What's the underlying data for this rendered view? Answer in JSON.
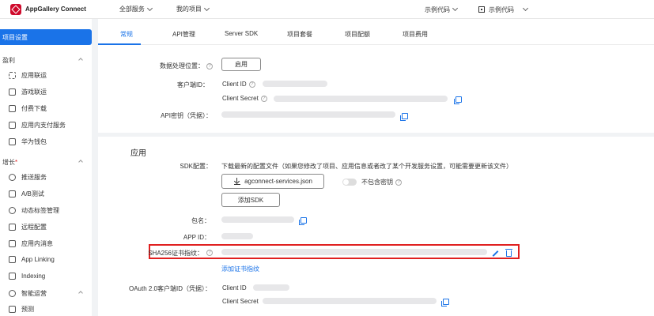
{
  "app": {
    "title": "AppGallery Connect"
  },
  "topnav": {
    "all_services": "全部服务",
    "my_projects": "我的项目",
    "example_code_1": "示例代码",
    "example_code_2": "示例代码"
  },
  "sidebar": {
    "active": "项目设置",
    "group_monetize": "盈利",
    "monetize_items": [
      "应用联运",
      "游戏联运",
      "付费下载",
      "应用内支付服务",
      "华为钱包"
    ],
    "group_grow": "增长",
    "grow_required_mark": "*",
    "grow_items": [
      "推送服务",
      "A/B测试",
      "动态标签管理",
      "远程配置",
      "应用内消息",
      "App Linking",
      "Indexing",
      "智能运营",
      "预测"
    ]
  },
  "tabs": [
    "常规",
    "API管理",
    "Server SDK",
    "项目套餐",
    "项目配额",
    "项目费用"
  ],
  "general": {
    "data_location_label": "数据处理位置：",
    "enable_button": "启用",
    "client_id_label": "客户端ID：",
    "client_id_key": "Client ID",
    "client_secret_key": "Client Secret",
    "api_key_label": "API密钥（凭据）："
  },
  "app_section": {
    "title": "应用",
    "sdk_config_label": "SDK配置：",
    "sdk_config_desc": "下载最新的配置文件（如果您修改了项目、应用信息或者改了某个开发服务设置，可能需要更新该文件）",
    "download_button": "agconnect-services.json",
    "no_key_toggle": "不包含密钥",
    "add_sdk_button": "添加SDK",
    "package_label": "包名：",
    "app_id_label": "APP ID：",
    "sha256_label": "SHA256证书指纹：",
    "add_cert_link": "添加证书指纹",
    "oauth_label": "OAuth 2.0客户端ID（凭据）：",
    "oauth_client_id_key": "Client ID",
    "oauth_client_secret_key": "Client Secret"
  },
  "colors": {
    "accent": "#1a73e8",
    "brand": "#cf0a2c",
    "highlight": "#e02020"
  }
}
